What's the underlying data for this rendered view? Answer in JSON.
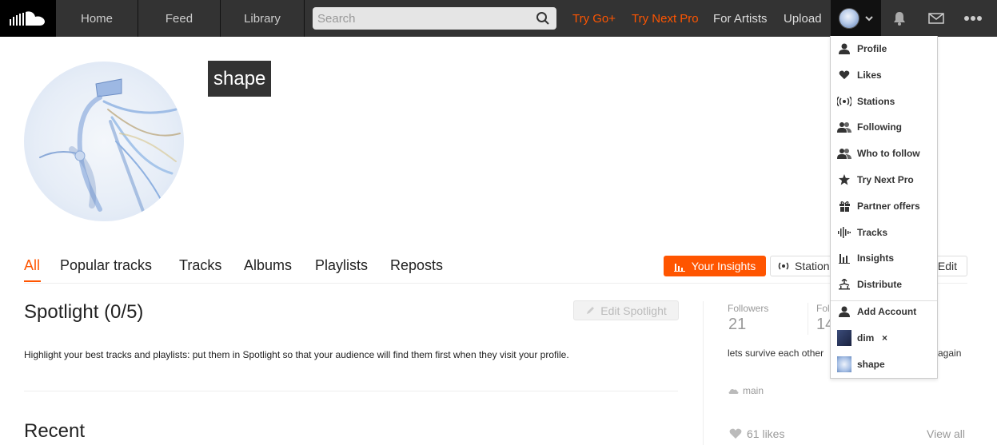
{
  "header": {
    "nav": [
      "Home",
      "Feed",
      "Library"
    ],
    "search_placeholder": "Search",
    "try_go": "Try Go+",
    "try_next_pro": "Try Next Pro",
    "for_artists": "For Artists",
    "upload": "Upload"
  },
  "profile": {
    "username": "shape"
  },
  "tabs": [
    "All",
    "Popular tracks",
    "Tracks",
    "Albums",
    "Playlists",
    "Reposts"
  ],
  "actions": {
    "insights": "Your Insights",
    "station": "Station",
    "edit": "Edit"
  },
  "spotlight": {
    "title": "Spotlight (0/5)",
    "edit_label": "Edit Spotlight",
    "description": "Highlight your best tracks and playlists: put them in Spotlight so that your audience will find them first when they visit your profile."
  },
  "recent": "Recent",
  "sidebar": {
    "followers_label": "Followers",
    "followers_value": "21",
    "following_label": "Fol",
    "following_value": "14",
    "bio_start": "lets survive each other",
    "bio_end": "again",
    "city": "main",
    "likes": "61 likes",
    "view_all": "View all"
  },
  "dropdown": {
    "items": [
      "Profile",
      "Likes",
      "Stations",
      "Following",
      "Who to follow",
      "Try Next Pro",
      "Partner offers",
      "Tracks",
      "Insights",
      "Distribute"
    ],
    "add_account": "Add Account",
    "accounts": [
      "dim",
      "shape"
    ],
    "close_symbol": "×"
  },
  "colors": {
    "accent": "#ff5500",
    "header_bg": "#333333"
  }
}
